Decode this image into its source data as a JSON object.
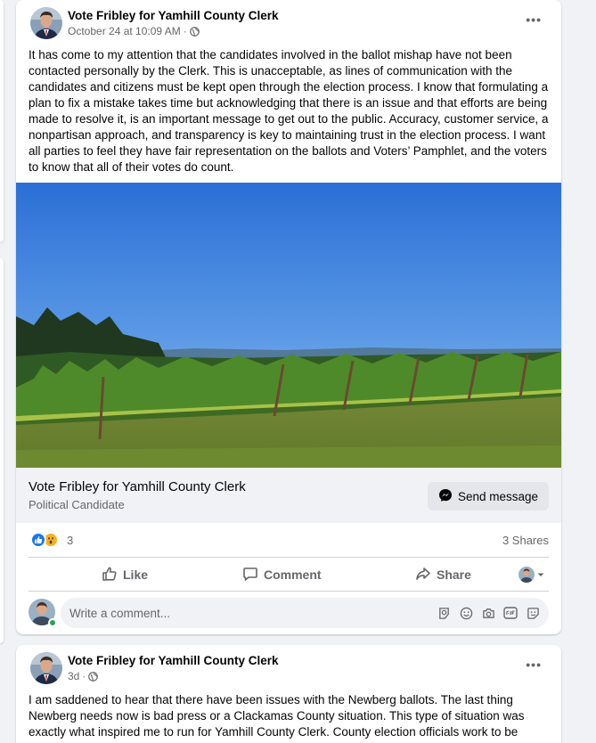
{
  "posts": [
    {
      "author": "Vote Fribley for Yamhill County Clerk",
      "timestamp": "October 24 at 10:09 AM",
      "separator": "·",
      "more_label": "•••",
      "text": "It has come to my attention that the candidates involved in the ballot mishap have not been contacted personally by the Clerk. This is unacceptable, as lines of communication with the candidates and citizens must be kept open through the election process. I know that formulating a plan to fix a mistake takes time but acknowledging that there is an issue and that efforts are being made to resolve it, is an important message to get out to the public. Accuracy, customer service, a nonpartisan approach, and transparency is key to maintaining trust in the election process. I want all parties to feel they have fair representation on the ballots and Voters’ Pamphlet, and the voters to know that all of their votes do count.",
      "page_card": {
        "name": "Vote Fribley for Yamhill County Clerk",
        "category": "Political Candidate",
        "button_label": "Send message"
      },
      "reactions": {
        "count": "3",
        "shares": "3 Shares"
      },
      "actions": {
        "like": "Like",
        "comment": "Comment",
        "share": "Share"
      },
      "comment_placeholder": "Write a comment..."
    },
    {
      "author": "Vote Fribley for Yamhill County Clerk",
      "timestamp": "3d",
      "separator": "·",
      "more_label": "•••",
      "text": "I am saddened to hear that there have been issues with the Newberg ballots. The last thing Newberg needs now is bad press or a Clackamas County situation. This type of situation was exactly what inspired me to run for Yamhill County Clerk. County election officials work to be"
    }
  ],
  "colors": {
    "link_blue": "#1877f2",
    "secondary_text": "#65676b",
    "online_green": "#31a24c",
    "wow_yellow": "#f7b125"
  }
}
